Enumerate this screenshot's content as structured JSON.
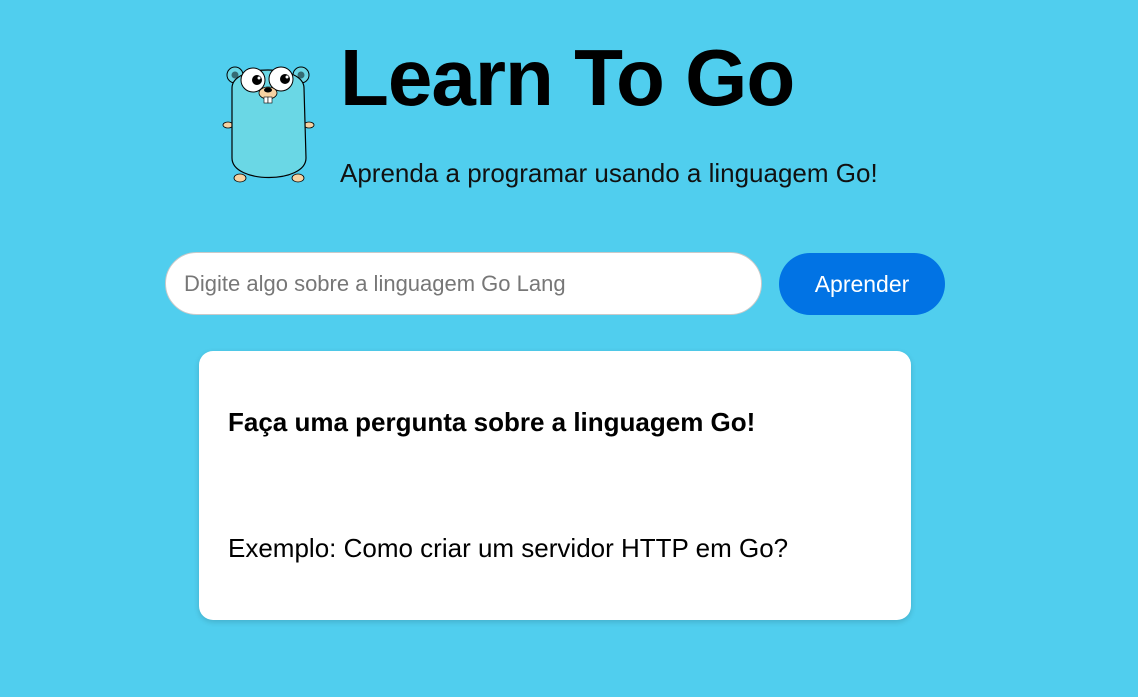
{
  "header": {
    "title": "Learn To Go",
    "subtitle": "Aprenda a programar usando a linguagem Go!",
    "logo_icon": "go-gopher-icon"
  },
  "search": {
    "placeholder": "Digite algo sobre a linguagem Go Lang",
    "value": "",
    "button_label": "Aprender"
  },
  "answer_card": {
    "heading": "Faça uma pergunta sobre a linguagem Go!",
    "example": "Exemplo: Como criar um servidor HTTP em Go?"
  },
  "colors": {
    "background": "#50CEEE",
    "button": "#0173E4",
    "card": "#FFFFFF",
    "gopher": "#6AD7E5"
  }
}
